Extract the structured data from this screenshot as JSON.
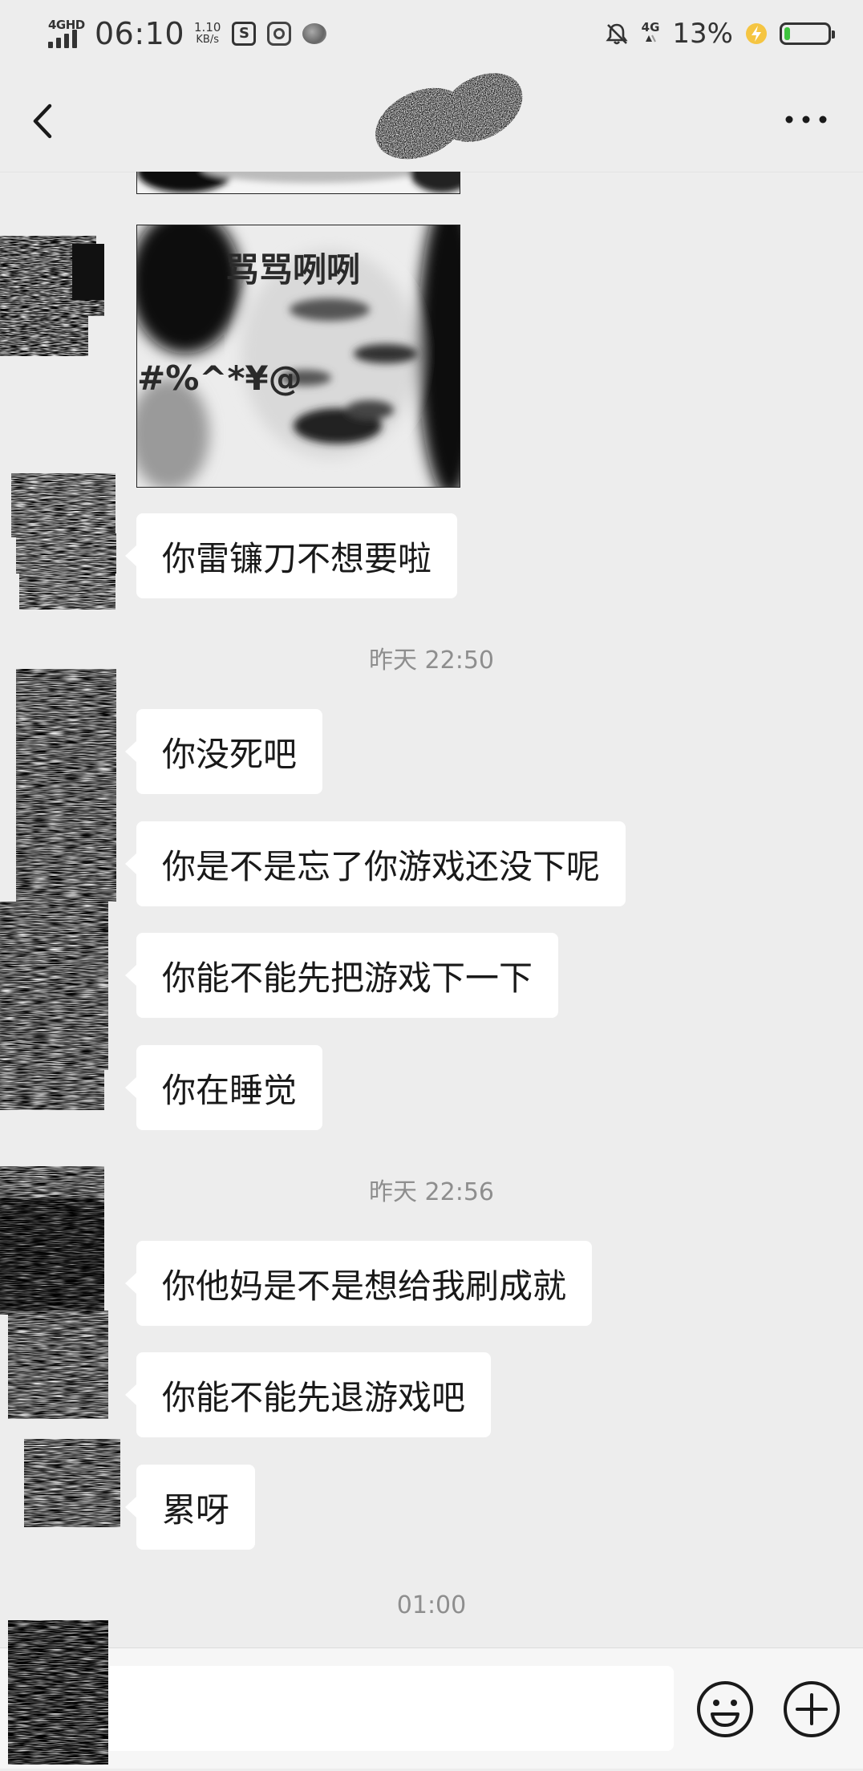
{
  "status_bar": {
    "network": "4GHD",
    "time": "06:10",
    "speed_value": "1.10",
    "speed_unit": "KB/s",
    "lte": "4G",
    "battery_text": "13%",
    "battery_level": 0.13,
    "app_icon_s": "S",
    "icons": [
      "signal-icon",
      "s-app-icon",
      "camera-app-icon",
      "blob-app-icon",
      "bell-off-icon",
      "lte-icon",
      "charge-icon",
      "battery-icon"
    ]
  },
  "title_bar": {
    "back_icon": "chevron-left-icon",
    "more_icon": "more-dots-icon"
  },
  "chat": {
    "image_message": {
      "meme_caption_top": "骂骂咧咧",
      "meme_caption_left": "#%^*¥@"
    },
    "messages": [
      {
        "text": "你雷镰刀不想要啦"
      },
      {
        "text": "你没死吧"
      },
      {
        "text": "你是不是忘了你游戏还没下呢"
      },
      {
        "text": "你能不能先把游戏下一下"
      },
      {
        "text": "你在睡觉"
      },
      {
        "text": "你他妈是不是想给我刷成就"
      },
      {
        "text": "你能不能先退游戏吧"
      },
      {
        "text": "累呀"
      }
    ],
    "timestamps": [
      {
        "text": "昨天 22:50"
      },
      {
        "text": "昨天 22:56"
      },
      {
        "text": "01:00"
      }
    ]
  },
  "input_bar": {
    "input_value": "",
    "emoji_icon": "emoji-icon",
    "plus_icon": "plus-circle-icon"
  },
  "colors": {
    "background": "#ededed",
    "bubble": "#ffffff",
    "timestamp": "#8e8e8e",
    "battery_fill": "#3ec43e",
    "charge": "#f5c542"
  }
}
